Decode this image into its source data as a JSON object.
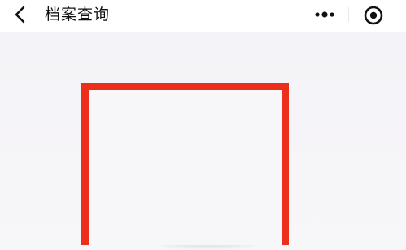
{
  "navbar": {
    "back_icon": "chevron-left-icon",
    "title": "档案查询",
    "more_icon": "more-dots-icon",
    "close_icon": "target-circle-icon"
  },
  "colors": {
    "frame": "#ec2f1a",
    "navbar_bg": "#ffffff",
    "page_bg": "#f6f5f8"
  }
}
